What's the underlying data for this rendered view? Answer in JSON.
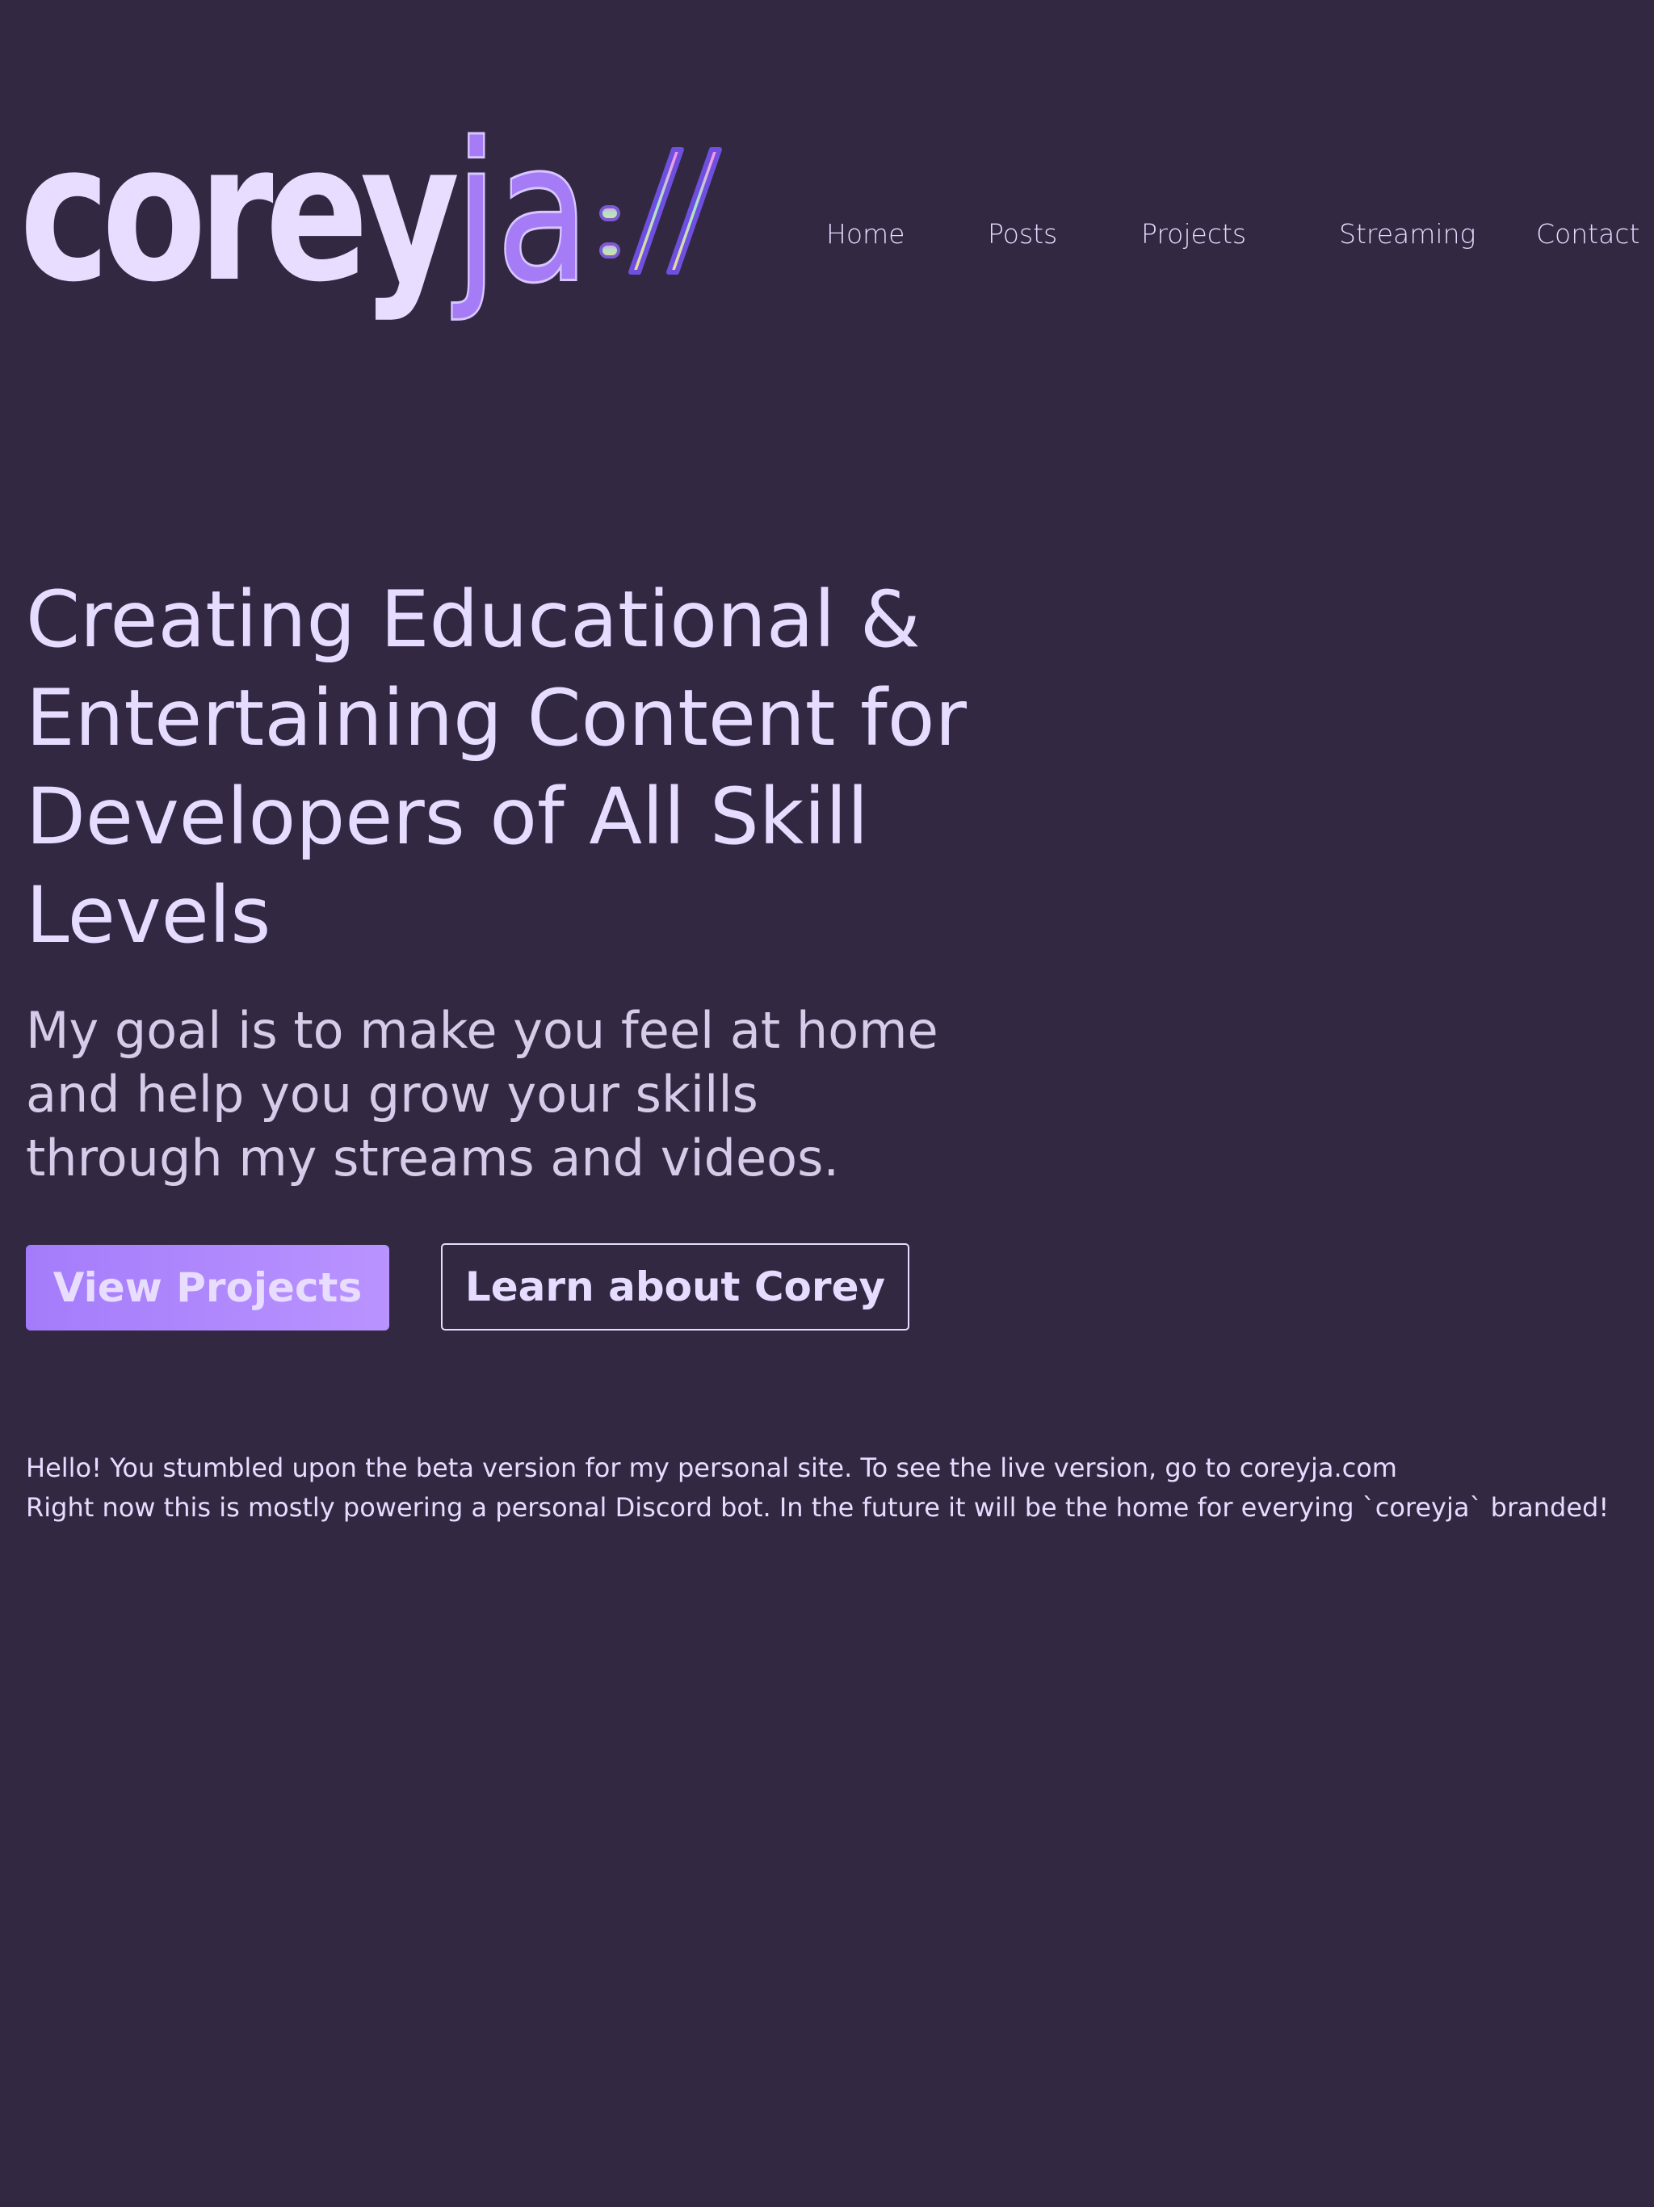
{
  "brand": {
    "logo_text": "coreyja://",
    "colors": {
      "background": "#322842",
      "text": "#e6dcff",
      "accent": "#b388ff"
    }
  },
  "nav": {
    "items": [
      {
        "label": "Home"
      },
      {
        "label": "Posts"
      },
      {
        "label": "Projects"
      },
      {
        "label": "Streaming"
      },
      {
        "label": "Contact"
      }
    ]
  },
  "hero": {
    "title": "Creating Educational & Entertaining Content for Developers of All Skill Levels",
    "subtitle": "My goal is to make you feel at home and help you grow your skills through my streams and videos."
  },
  "actions": {
    "primary_label": "View Projects",
    "secondary_label": "Learn about Corey"
  },
  "notice": {
    "line1": "Hello! You stumbled upon the beta version for my personal site. To see the live version, go to coreyja.com",
    "line2": "Right now this is mostly powering a personal Discord bot. In the future it will be the home for everying `coreyja` branded!"
  }
}
